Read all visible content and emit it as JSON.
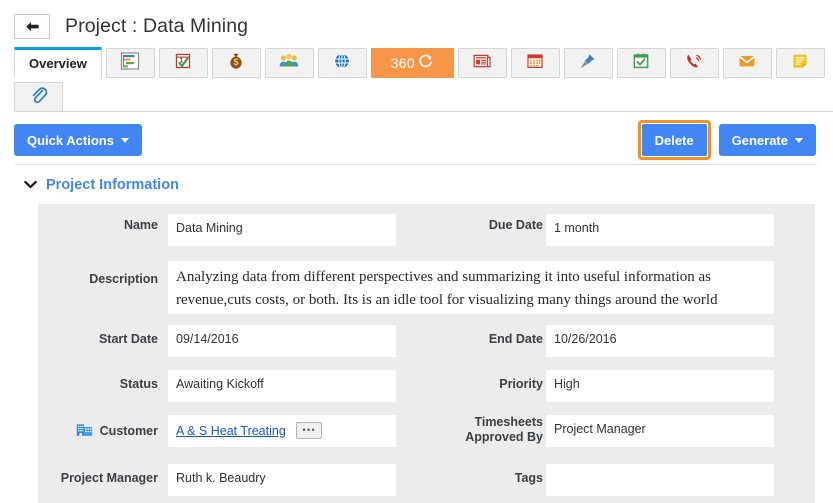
{
  "header": {
    "back_icon": "arrow-left-icon",
    "title": "Project : Data Mining"
  },
  "tabs": {
    "row1": [
      {
        "label": "Overview",
        "icon": null,
        "active": true,
        "style": "text"
      },
      {
        "label": "",
        "icon": "gantt-chart-icon",
        "active": false,
        "style": "icon"
      },
      {
        "label": "",
        "icon": "calendar-check-icon",
        "active": false,
        "style": "icon"
      },
      {
        "label": "",
        "icon": "money-bag-icon",
        "active": false,
        "style": "icon"
      },
      {
        "label": "",
        "icon": "people-group-icon",
        "active": false,
        "style": "icon"
      },
      {
        "label": "",
        "icon": "globe-icon",
        "active": false,
        "style": "icon"
      },
      {
        "label": "360",
        "icon": "refresh-360-icon",
        "active": false,
        "style": "orange"
      },
      {
        "label": "",
        "icon": "news-list-icon",
        "active": false,
        "style": "icon"
      },
      {
        "label": "",
        "icon": "calendar-red-icon",
        "active": false,
        "style": "icon"
      },
      {
        "label": "",
        "icon": "pushpin-icon",
        "active": false,
        "style": "icon"
      },
      {
        "label": "",
        "icon": "calendar-green-check-icon",
        "active": false,
        "style": "icon"
      },
      {
        "label": "",
        "icon": "phone-ring-icon",
        "active": false,
        "style": "icon"
      },
      {
        "label": "",
        "icon": "envelope-icon",
        "active": false,
        "style": "icon"
      },
      {
        "label": "",
        "icon": "note-icon",
        "active": false,
        "style": "icon"
      }
    ],
    "row2": [
      {
        "label": "",
        "icon": "paperclip-icon",
        "active": false,
        "style": "icon"
      }
    ]
  },
  "toolbar": {
    "quick_actions_label": "Quick Actions",
    "delete_label": "Delete",
    "generate_label": "Generate",
    "delete_focused": true,
    "focus_color": "#f0921e",
    "primary_color": "#4285f4"
  },
  "section": {
    "title": "Project Information",
    "expanded": true,
    "chevron_icon": "chevron-down-icon",
    "accent_color": "#4285f4"
  },
  "form": {
    "left": [
      {
        "label": "Name",
        "value": "Data Mining",
        "icon": null
      },
      {
        "label": "Description",
        "value": "Analyzing data from different perspectives and summarizing it into useful information as revenue,cuts costs, or both. Its is an idle tool for visualizing many things around the world",
        "icon": null
      },
      {
        "label": "Start Date",
        "value": "09/14/2016",
        "icon": null
      },
      {
        "label": "Status",
        "value": "Awaiting Kickoff",
        "icon": null
      },
      {
        "label": "Customer",
        "value": "A & S Heat Treating",
        "icon": "office-building-icon",
        "is_link": true,
        "lookup_label": "•••"
      },
      {
        "label": "Project Manager",
        "value": "Ruth k. Beaudry",
        "icon": null
      }
    ],
    "right": [
      {
        "label": "Due Date",
        "value": "1 month",
        "icon": null
      },
      {
        "label": "End Date",
        "value": "10/26/2016",
        "icon": null
      },
      {
        "label": "Priority",
        "value": "High",
        "icon": null
      },
      {
        "label": "Timesheets Approved By",
        "label_line1": "Timesheets",
        "label_line2": "Approved By",
        "value": "Project Manager",
        "icon": null
      },
      {
        "label": "Tags",
        "value": "",
        "icon": null
      }
    ]
  }
}
